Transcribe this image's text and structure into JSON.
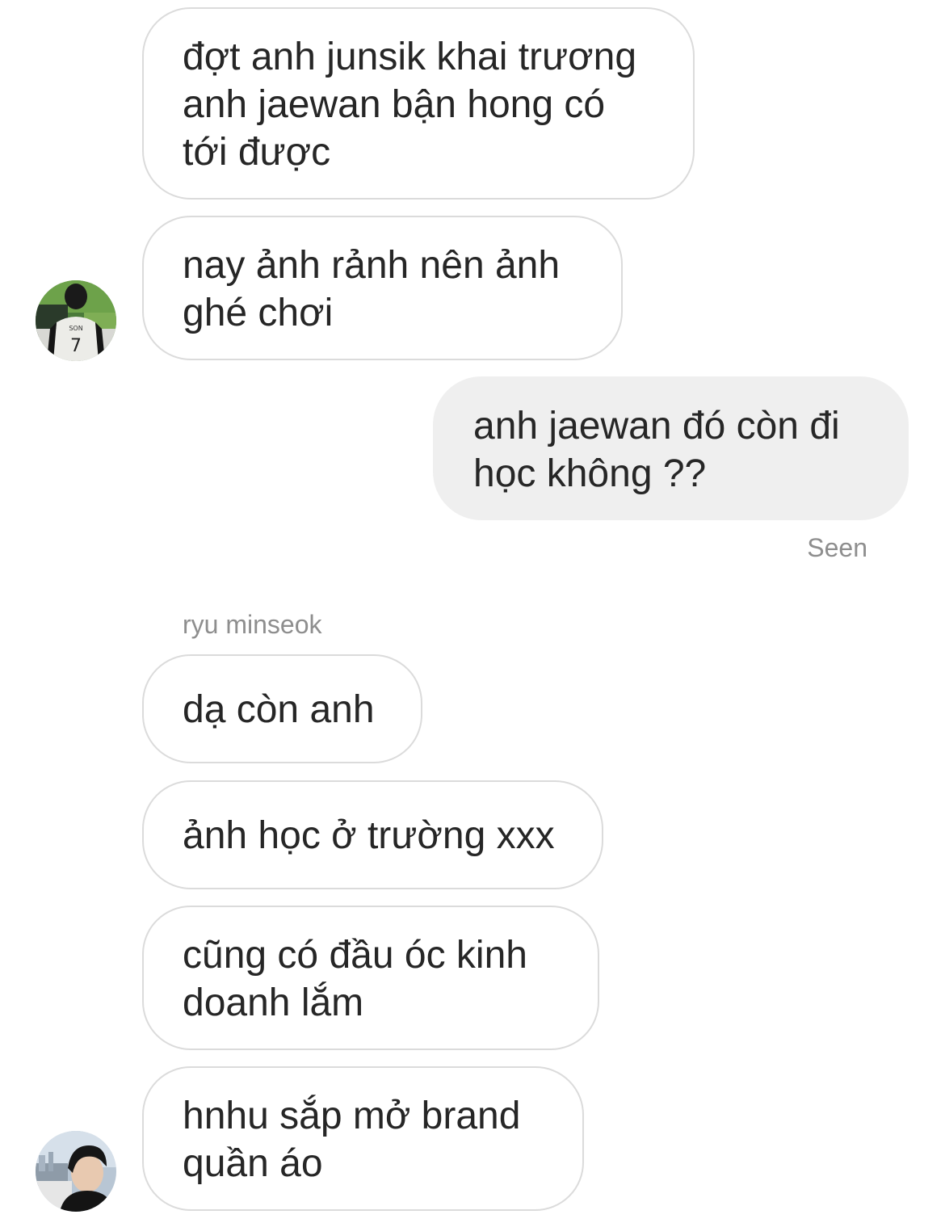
{
  "conversation": {
    "messages": [
      {
        "direction": "incoming",
        "text": "đợt anh junsik khai trương anh jaewan bận hong có tới được"
      },
      {
        "direction": "incoming",
        "text": "nay ảnh rảnh nên ảnh ghé chơi"
      },
      {
        "direction": "outgoing",
        "text": "anh jaewan đó còn đi học không ??"
      },
      {
        "direction": "incoming",
        "text": "dạ còn anh"
      },
      {
        "direction": "incoming",
        "text": "ảnh học ở trường xxx"
      },
      {
        "direction": "incoming",
        "text": "cũng có đầu óc kinh doanh lắm"
      },
      {
        "direction": "incoming",
        "text": "hnhu sắp mở brand quần áo"
      }
    ],
    "seen_label": "Seen",
    "sender_name": "ryu minseok"
  },
  "avatars": {
    "first_sender": {
      "icon": "profile-photo-stadium",
      "jersey_name": "SON",
      "jersey_number": "7"
    },
    "second_sender": {
      "icon": "profile-photo-portrait"
    }
  },
  "colors": {
    "incoming_border": "#dbdbdb",
    "outgoing_background": "#efefef",
    "text": "#262626",
    "meta_text": "#8e8e8e"
  }
}
